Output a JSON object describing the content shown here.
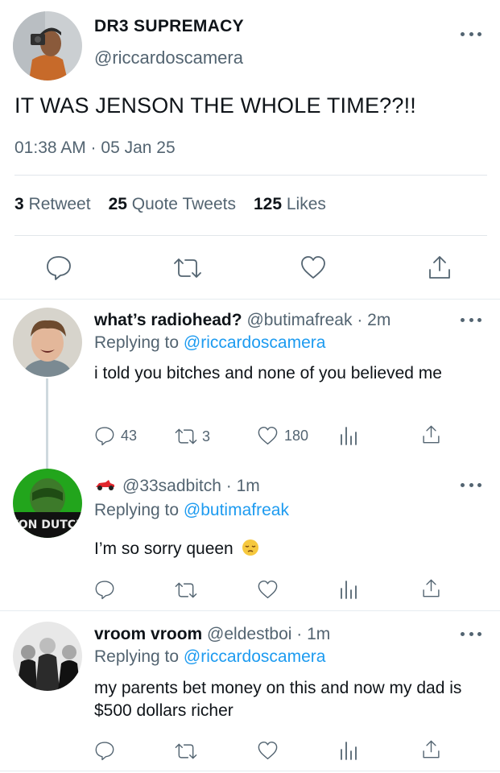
{
  "main_tweet": {
    "name": "DR3 SUPREMACY",
    "handle": "@riccardoscamera",
    "text": "IT WAS JENSON THE WHOLE TIME??!!",
    "timestamp": "01:38 AM · 05 Jan 25",
    "stats": {
      "retweets_count": "3",
      "retweets_label": "Retweet",
      "quotes_count": "25",
      "quotes_label": "Quote Tweets",
      "likes_count": "125",
      "likes_label": "Likes"
    },
    "actions": [
      "reply-icon",
      "retweet-icon",
      "like-icon",
      "share-icon"
    ]
  },
  "replies": [
    {
      "name": "what’s radiohead?",
      "handle": "@butimafreak",
      "time": "· 2m",
      "replying_label": "Replying to",
      "replying_to": "@riccardoscamera",
      "text": "i told you bitches and none of you believed me",
      "reply_count": "43",
      "retweet_count": "3",
      "like_count": "180"
    },
    {
      "name": "",
      "name_icon": "race-car-emoji",
      "handle": "@33sadbitch",
      "time": "· 1m",
      "replying_label": "Replying to",
      "replying_to": "@butimafreak",
      "text": "I’m so sorry queen",
      "text_emoji": "pensive-face-emoji",
      "avatar_text": "VON DUTCH"
    },
    {
      "name": "vroom vroom",
      "handle": "@eldestboi",
      "time": "· 1m",
      "replying_label": "Replying to",
      "replying_to": "@riccardoscamera",
      "text": "my parents bet money on this and now my dad is $500 dollars richer"
    }
  ],
  "colors": {
    "link": "#1d9bf0",
    "secondary_text": "#536471",
    "primary_text": "#0f1419",
    "divider": "#e6ecf0"
  }
}
